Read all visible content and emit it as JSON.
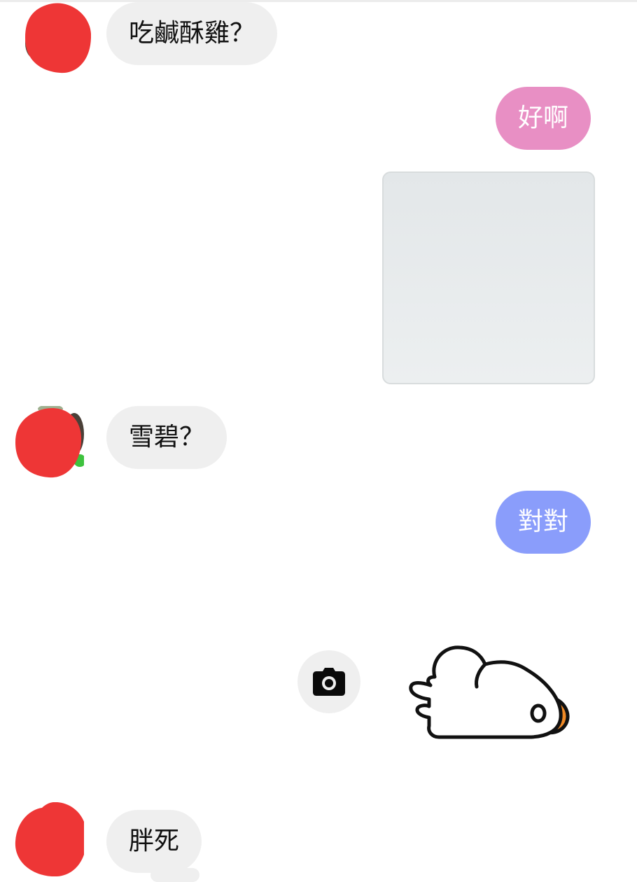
{
  "messages": [
    {
      "sender": "other",
      "text": "吃鹹酥雞？"
    },
    {
      "sender": "me",
      "text": "好啊"
    },
    {
      "sender": "me",
      "type": "photo"
    },
    {
      "sender": "other",
      "text": "雪碧？"
    },
    {
      "sender": "me",
      "text": "對對"
    },
    {
      "sender": "me",
      "type": "sticker"
    },
    {
      "sender": "other",
      "text": "胖死"
    }
  ],
  "colors": {
    "incoming_bubble": "#efefef",
    "outgoing_pink": "#e88fc4",
    "outgoing_blue": "#8a9dfb",
    "avatar_redaction": "#ee3636"
  },
  "icons": {
    "camera_button": "camera-icon",
    "sticker": "duck-sticker"
  }
}
